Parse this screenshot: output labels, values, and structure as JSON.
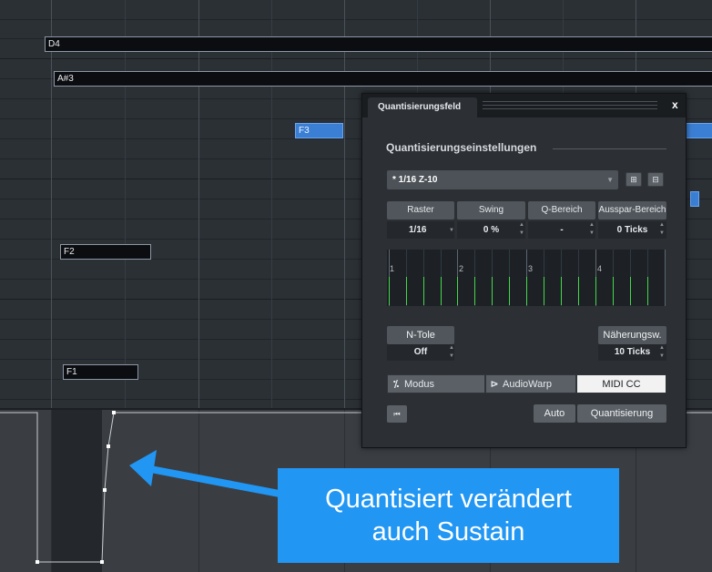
{
  "notes": [
    {
      "label": "D4"
    },
    {
      "label": "A#3"
    },
    {
      "label": "F3"
    },
    {
      "label": "F2"
    },
    {
      "label": "F1"
    }
  ],
  "panel": {
    "title": "Quantisierungsfeld",
    "close": "x",
    "section_title": "Quantisierungseinstellungen",
    "preset": "* 1/16  Z-10",
    "params": [
      {
        "label": "Raster",
        "value": "1/16"
      },
      {
        "label": "Swing",
        "value": "0 %"
      },
      {
        "label": "Q-Bereich",
        "value": "-"
      },
      {
        "label": "Ausspar-Bereich",
        "value": "0 Ticks"
      }
    ],
    "grid_beats": [
      "1",
      "2",
      "3",
      "4"
    ],
    "ntole": {
      "label": "N-Tole",
      "value": "Off"
    },
    "naeherung": {
      "label": "Näherungsw.",
      "value": "10 Ticks"
    },
    "modes": [
      {
        "label": "Modus",
        "icon": "quantize-icon"
      },
      {
        "label": "AudioWarp",
        "icon": "audiowarp-icon"
      },
      {
        "label": "MIDI CC",
        "icon": ""
      }
    ],
    "active_mode": "MIDI CC",
    "auto_label": "Auto",
    "quantize_label": "Quantisierung"
  },
  "callout": {
    "line1": "Quantisiert verändert",
    "line2": "auch Sustain"
  },
  "colors": {
    "callout": "#2196f3",
    "selected_note": "#3b7fd4",
    "grid_marker": "#45d84a"
  }
}
